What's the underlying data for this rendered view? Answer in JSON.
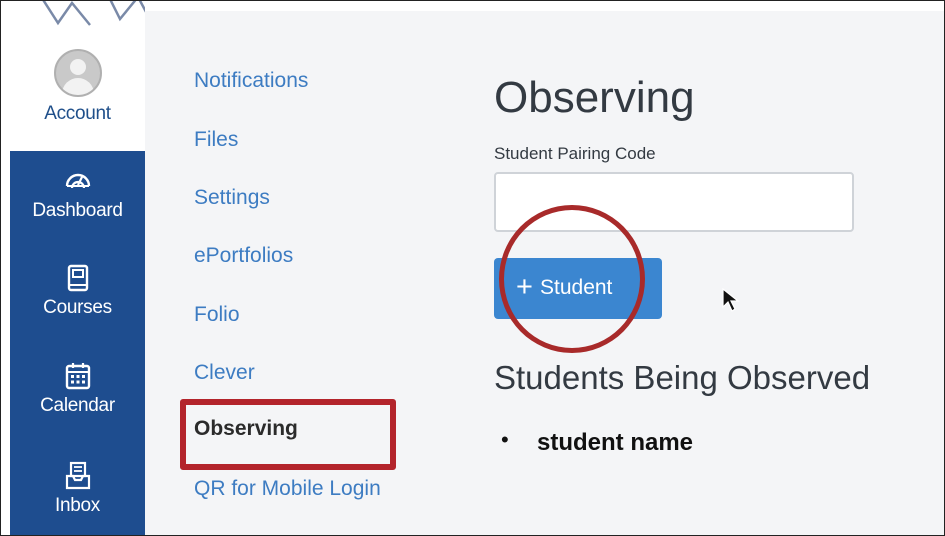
{
  "global_nav": {
    "items": [
      {
        "label": "Account",
        "icon": "user-avatar-icon"
      },
      {
        "label": "Dashboard",
        "icon": "dashboard-gauge-icon"
      },
      {
        "label": "Courses",
        "icon": "book-icon"
      },
      {
        "label": "Calendar",
        "icon": "calendar-icon"
      },
      {
        "label": "Inbox",
        "icon": "inbox-icon"
      }
    ],
    "active_color": "#1e4d8f"
  },
  "account_nav": {
    "items": [
      {
        "label": "Notifications"
      },
      {
        "label": "Files"
      },
      {
        "label": "Settings"
      },
      {
        "label": "ePortfolios"
      },
      {
        "label": "Folio"
      },
      {
        "label": "Clever"
      },
      {
        "label": "Observing"
      },
      {
        "label": "QR for Mobile Login"
      }
    ],
    "active_item": "Observing",
    "link_color": "#3d7cc2"
  },
  "main": {
    "title": "Observing",
    "pairing_code_label": "Student Pairing Code",
    "pairing_code_value": "",
    "add_button_label": "Student",
    "add_button_icon": "plus-icon",
    "add_button_color": "#3b86d0",
    "observed_heading": "Students Being Observed",
    "observed_students": [
      "student name"
    ]
  },
  "annotations": {
    "highlight_color": "#b3242b"
  }
}
